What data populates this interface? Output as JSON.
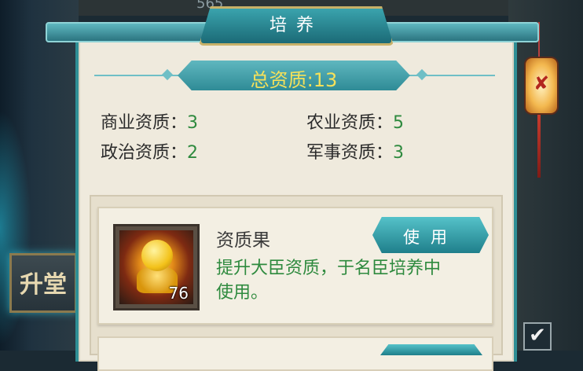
{
  "background": {
    "top_number": "565",
    "left_badge_text": "升堂"
  },
  "dialog": {
    "title": "培养",
    "total": {
      "label": "总资质",
      "sep": ":",
      "value": "13"
    },
    "stats": [
      {
        "label": "商业资质：",
        "value": "3"
      },
      {
        "label": "农业资质：",
        "value": "5"
      },
      {
        "label": "政治资质：",
        "value": "2"
      },
      {
        "label": "军事资质：",
        "value": "3"
      }
    ],
    "items": [
      {
        "name": "资质果",
        "count": "76",
        "description": "提升大臣资质，于名臣培养中使用。",
        "button_label": "使用"
      }
    ]
  },
  "colors": {
    "accent_teal": "#2f8b96",
    "value_green": "#2e8a3e",
    "total_gold": "#f5e15a"
  },
  "icons": [
    "lantern-icon",
    "checkbox-icon",
    "fruit-item-icon"
  ]
}
